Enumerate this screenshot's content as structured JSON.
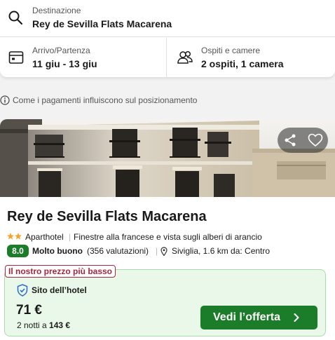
{
  "search": {
    "destination_label": "Destinazione",
    "destination_value": "Rey de Sevilla Flats Macarena",
    "dates_label": "Arrivo/Partenza",
    "dates_value": "11 giu - 13 giu",
    "guests_label": "Ospiti e camere",
    "guests_value": "2 ospiti, 1 camera",
    "icons": {
      "destination": "search-icon",
      "dates": "calendar-icon",
      "guests": "guests-icon"
    }
  },
  "info": {
    "text": "Come i pagamenti influiscono sul posizionamento",
    "icon": "info-icon"
  },
  "hotel": {
    "name": "Rey de Sevilla Flats Macarena",
    "stars": 2,
    "type": "Aparthotel",
    "separator": "|",
    "description": "Finestre alla francese e vista sugli alberi di arancio",
    "rating_score": "8.0",
    "rating_word": "Molto buono",
    "rating_count": "(356 valutazioni)",
    "location": "Siviglia, 1.6 km da: Centro",
    "actions": {
      "share_icon": "share-icon",
      "favorite_icon": "heart-icon"
    }
  },
  "deal": {
    "tag": "Il nostro prezzo più basso",
    "provider": "Sito dell’hotel",
    "price": "71 €",
    "nights_prefix": "2 notti a",
    "nights_total": "143 €",
    "cta_label": "Vedi l’offerta"
  },
  "colors": {
    "accent_green": "#1b7c2a",
    "deal_background": "#eaf8ea",
    "tag_red": "#a8263e",
    "star_orange": "#f4a22d",
    "badge_blue": "#2a6bd1"
  }
}
